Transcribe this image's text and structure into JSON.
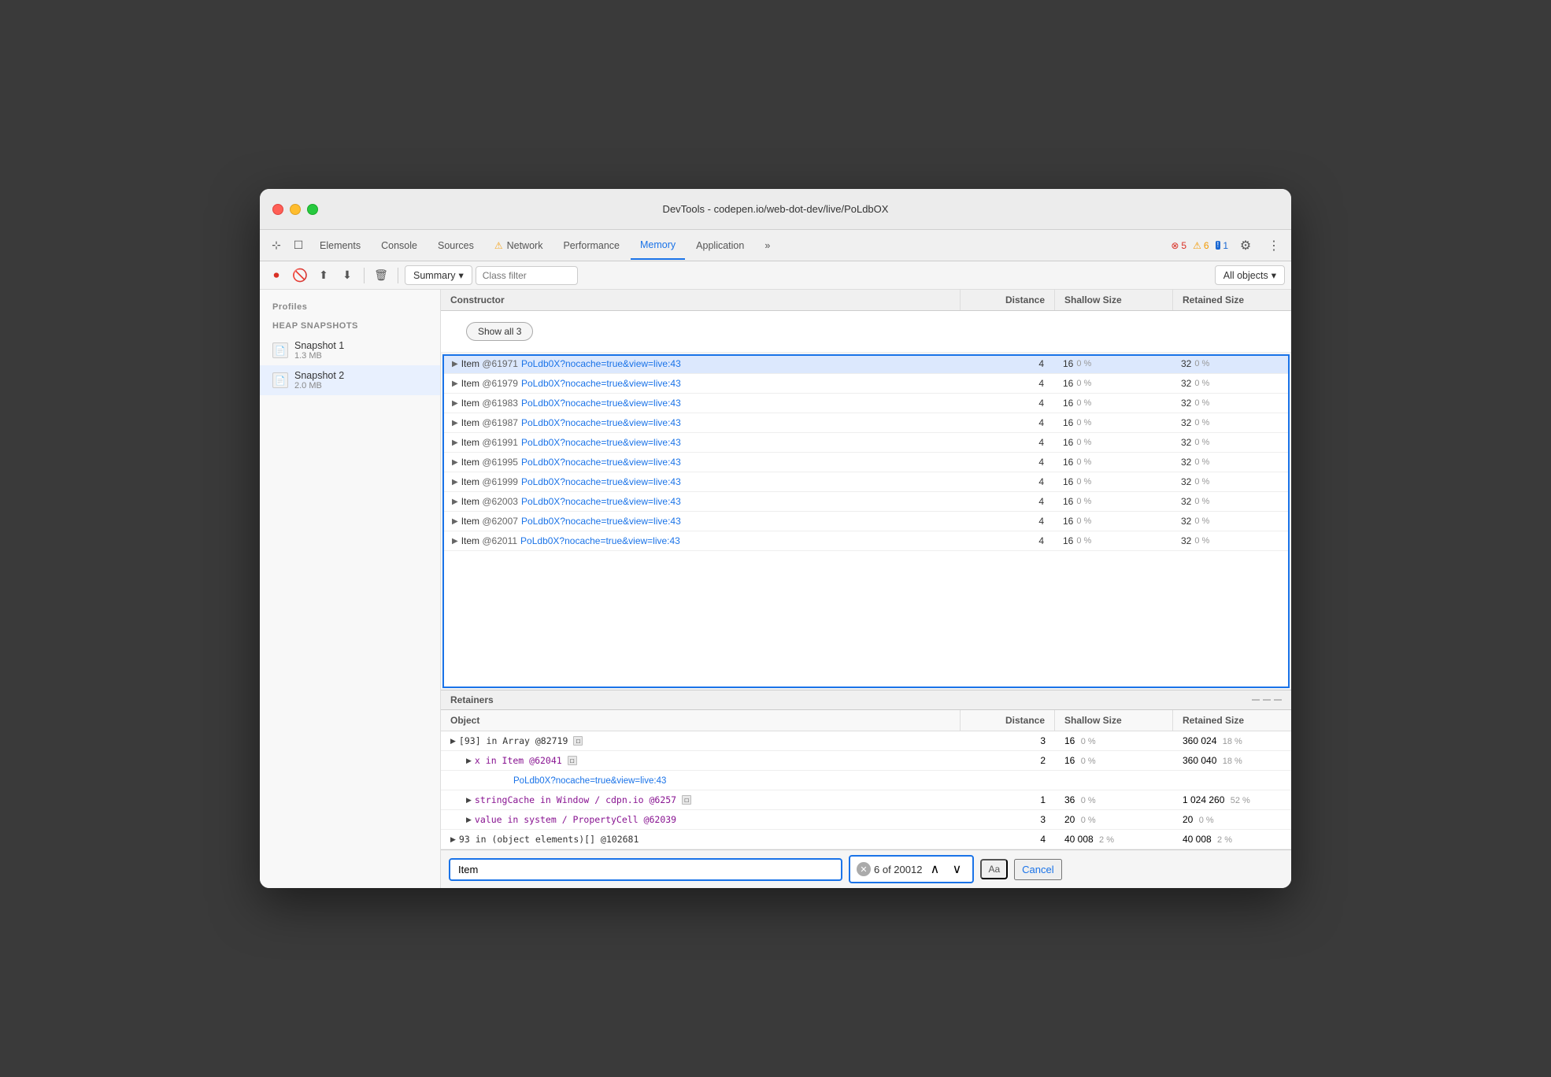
{
  "window": {
    "title": "DevTools - codepen.io/web-dot-dev/live/PoLdbOX"
  },
  "tabs": [
    {
      "label": "Elements",
      "active": false
    },
    {
      "label": "Console",
      "active": false
    },
    {
      "label": "Sources",
      "active": false
    },
    {
      "label": "Network",
      "active": false,
      "warn": true
    },
    {
      "label": "Performance",
      "active": false
    },
    {
      "label": "Memory",
      "active": true
    },
    {
      "label": "Application",
      "active": false
    }
  ],
  "badges": {
    "errors": "5",
    "warnings": "6",
    "info": "1"
  },
  "toolbar": {
    "summary_label": "Summary",
    "class_filter_placeholder": "Class filter",
    "all_objects_label": "All objects"
  },
  "profiles": {
    "section_title": "HEAP SNAPSHOTS",
    "items": [
      {
        "name": "Snapshot 1",
        "size": "1.3 MB"
      },
      {
        "name": "Snapshot 2",
        "size": "2.0 MB"
      }
    ]
  },
  "constructor_table": {
    "headers": [
      "Constructor",
      "Distance",
      "Shallow Size",
      "Retained Size"
    ],
    "show_all_btn": "Show all 3",
    "rows": [
      {
        "name": "Item",
        "id": "@61971",
        "link": "PoLdb0X?nocache=true&view=live:43",
        "distance": "4",
        "shallow": "16",
        "shallow_pct": "0 %",
        "retained": "32",
        "retained_pct": "0 %",
        "selected": true
      },
      {
        "name": "Item",
        "id": "@61979",
        "link": "PoLdb0X?nocache=true&view=live:43",
        "distance": "4",
        "shallow": "16",
        "shallow_pct": "0 %",
        "retained": "32",
        "retained_pct": "0 %"
      },
      {
        "name": "Item",
        "id": "@61983",
        "link": "PoLdb0X?nocache=true&view=live:43",
        "distance": "4",
        "shallow": "16",
        "shallow_pct": "0 %",
        "retained": "32",
        "retained_pct": "0 %"
      },
      {
        "name": "Item",
        "id": "@61987",
        "link": "PoLdb0X?nocache=true&view=live:43",
        "distance": "4",
        "shallow": "16",
        "shallow_pct": "0 %",
        "retained": "32",
        "retained_pct": "0 %"
      },
      {
        "name": "Item",
        "id": "@61991",
        "link": "PoLdb0X?nocache=true&view=live:43",
        "distance": "4",
        "shallow": "16",
        "shallow_pct": "0 %",
        "retained": "32",
        "retained_pct": "0 %"
      },
      {
        "name": "Item",
        "id": "@61995",
        "link": "PoLdb0X?nocache=true&view=live:43",
        "distance": "4",
        "shallow": "16",
        "shallow_pct": "0 %",
        "retained": "32",
        "retained_pct": "0 %"
      },
      {
        "name": "Item",
        "id": "@61999",
        "link": "PoLdb0X?nocache=true&view=live:43",
        "distance": "4",
        "shallow": "16",
        "shallow_pct": "0 %",
        "retained": "32",
        "retained_pct": "0 %"
      },
      {
        "name": "Item",
        "id": "@62003",
        "link": "PoLdb0X?nocache=true&view=live:43",
        "distance": "4",
        "shallow": "16",
        "shallow_pct": "0 %",
        "retained": "32",
        "retained_pct": "0 %"
      },
      {
        "name": "Item",
        "id": "@62007",
        "link": "PoLdb0X?nocache=true&view=live:43",
        "distance": "4",
        "shallow": "16",
        "shallow_pct": "0 %",
        "retained": "32",
        "retained_pct": "0 %"
      },
      {
        "name": "Item",
        "id": "@62011",
        "link": "PoLdb0X?nocache=true&view=live:43",
        "distance": "4",
        "shallow": "16",
        "shallow_pct": "0 %",
        "retained": "32",
        "retained_pct": "0 %"
      }
    ]
  },
  "retainers": {
    "title": "Retainers",
    "headers": [
      "Object",
      "Distance",
      "Shallow Size",
      "Retained Size"
    ],
    "rows": [
      {
        "indent": 0,
        "object": "[93] in Array @82719",
        "has_icon": true,
        "distance": "3",
        "shallow": "16",
        "shallow_pct": "0 %",
        "retained": "360 024",
        "retained_pct": "18 %"
      },
      {
        "indent": 1,
        "object": "x in Item @62041",
        "has_icon": true,
        "distance": "2",
        "shallow": "16",
        "shallow_pct": "0 %",
        "retained": "360 040",
        "retained_pct": "18 %"
      },
      {
        "indent": 2,
        "is_link": true,
        "object": "PoLdb0X?nocache=true&view=live:43",
        "distance": "",
        "shallow": "",
        "shallow_pct": "",
        "retained": "",
        "retained_pct": ""
      },
      {
        "indent": 1,
        "object": "stringCache in Window / cdpn.io @6257",
        "has_icon": true,
        "distance": "1",
        "shallow": "36",
        "shallow_pct": "0 %",
        "retained": "1 024 260",
        "retained_pct": "52 %"
      },
      {
        "indent": 1,
        "object": "value in system / PropertyCell @62039",
        "distance": "3",
        "shallow": "20",
        "shallow_pct": "0 %",
        "retained": "20",
        "retained_pct": "0 %"
      },
      {
        "indent": 0,
        "object": "93 in (object elements)[] @102681",
        "distance": "4",
        "shallow": "40 008",
        "shallow_pct": "2 %",
        "retained": "40 008",
        "retained_pct": "2 %"
      }
    ]
  },
  "search": {
    "value": "Item",
    "count": "6 of 20012",
    "match_case_label": "Aa",
    "cancel_label": "Cancel"
  }
}
